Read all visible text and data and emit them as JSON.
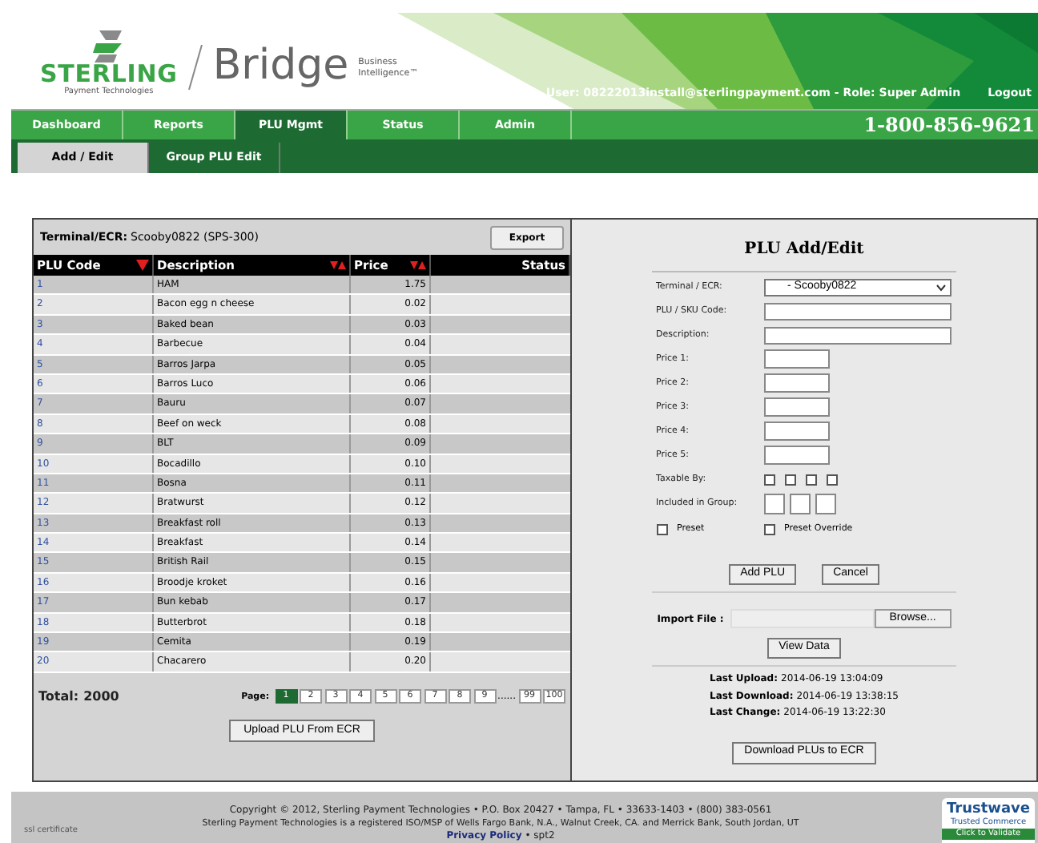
{
  "header": {
    "brand": "STERLING",
    "brand_tagline": "Payment Technologies",
    "product": "Bridge",
    "product_tagline": [
      "Business",
      "Intelligence™"
    ],
    "user_info": "User: 08222013install@sterlingpayment.com - Role: Super Admin",
    "logout": "Logout"
  },
  "nav": {
    "tabs": [
      {
        "label": "Dashboard",
        "selected": false
      },
      {
        "label": "Reports",
        "selected": false
      },
      {
        "label": "PLU Mgmt",
        "selected": true
      },
      {
        "label": "Status",
        "selected": false
      },
      {
        "label": "Admin",
        "selected": false
      }
    ],
    "phone": "1-800-856-9621"
  },
  "subnav": {
    "tabs": [
      {
        "label": "Add / Edit",
        "selected": true
      },
      {
        "label": "Group PLU Edit",
        "selected": false
      }
    ]
  },
  "plu_list": {
    "terminal_label": "Terminal/ECR:",
    "terminal_value": "Scooby0822 (SPS-300)",
    "export_button": "Export",
    "columns": [
      {
        "label": "PLU Code",
        "kind": "sorted"
      },
      {
        "label": "Description",
        "kind": "sortable"
      },
      {
        "label": "Price",
        "kind": "sortable"
      },
      {
        "label": "Status",
        "kind": "plain"
      }
    ],
    "rows": [
      {
        "code": "1",
        "description": "HAM",
        "price": "1.75"
      },
      {
        "code": "2",
        "description": "Bacon egg n cheese",
        "price": "0.02"
      },
      {
        "code": "3",
        "description": "Baked bean",
        "price": "0.03"
      },
      {
        "code": "4",
        "description": "Barbecue",
        "price": "0.04"
      },
      {
        "code": "5",
        "description": "Barros Jarpa",
        "price": "0.05"
      },
      {
        "code": "6",
        "description": "Barros Luco",
        "price": "0.06"
      },
      {
        "code": "7",
        "description": "Bauru",
        "price": "0.07"
      },
      {
        "code": "8",
        "description": "Beef on weck",
        "price": "0.08"
      },
      {
        "code": "9",
        "description": "BLT",
        "price": "0.09"
      },
      {
        "code": "10",
        "description": "Bocadillo",
        "price": "0.10"
      },
      {
        "code": "11",
        "description": "Bosna",
        "price": "0.11"
      },
      {
        "code": "12",
        "description": "Bratwurst",
        "price": "0.12"
      },
      {
        "code": "13",
        "description": "Breakfast roll",
        "price": "0.13"
      },
      {
        "code": "14",
        "description": "Breakfast",
        "price": "0.14"
      },
      {
        "code": "15",
        "description": "British Rail",
        "price": "0.15"
      },
      {
        "code": "16",
        "description": "Broodje kroket",
        "price": "0.16"
      },
      {
        "code": "17",
        "description": "Bun kebab",
        "price": "0.17"
      },
      {
        "code": "18",
        "description": "Butterbrot",
        "price": "0.18"
      },
      {
        "code": "19",
        "description": "Cemita",
        "price": "0.19"
      },
      {
        "code": "20",
        "description": "Chacarero",
        "price": "0.20"
      }
    ],
    "total_label": "Total:",
    "total_value": "2000",
    "page_label": "Page:",
    "pages": [
      {
        "label": "1",
        "selected": true
      },
      {
        "label": "2",
        "selected": false
      },
      {
        "label": "3",
        "selected": false
      },
      {
        "label": "4",
        "selected": false
      },
      {
        "label": "5",
        "selected": false
      },
      {
        "label": "6",
        "selected": false
      },
      {
        "label": "7",
        "selected": false
      },
      {
        "label": "8",
        "selected": false
      },
      {
        "label": "9",
        "selected": false
      }
    ],
    "pages_ellipsis": "......",
    "last_pages": [
      {
        "label": "99",
        "selected": false
      },
      {
        "label": "100",
        "selected": false
      }
    ],
    "upload_button": "Upload PLU From ECR"
  },
  "form": {
    "title": "PLU Add/Edit",
    "fields": [
      {
        "label": "Terminal / ECR:",
        "kind": "select",
        "value": "- Scooby0822"
      },
      {
        "label": "PLU / SKU Code:",
        "kind": "wide"
      },
      {
        "label": "Description:",
        "kind": "wide"
      },
      {
        "label": "Price 1:",
        "kind": "short"
      },
      {
        "label": "Price 2:",
        "kind": "short"
      },
      {
        "label": "Price 3:",
        "kind": "short"
      },
      {
        "label": "Price 4:",
        "kind": "short"
      },
      {
        "label": "Price 5:",
        "kind": "short"
      }
    ],
    "taxable_label": "Taxable By:",
    "taxable": [
      {
        "checked": false
      },
      {
        "checked": false
      },
      {
        "checked": false
      },
      {
        "checked": false
      }
    ],
    "group_label": "Included in Group:",
    "presets": [
      {
        "label": "Preset",
        "checked": false
      },
      {
        "label": "Preset Override",
        "checked": false
      }
    ],
    "buttons": [
      "Add PLU",
      "Cancel"
    ],
    "import_label": "Import File :",
    "browse_button": "Browse...",
    "view_button": "View Data",
    "history": [
      {
        "label": "Last Upload:",
        "value": "2014-06-19 13:04:09"
      },
      {
        "label": "Last Download:",
        "value": "2014-06-19 13:38:15"
      },
      {
        "label": "Last Change:",
        "value": "2014-06-19 13:22:30"
      }
    ],
    "download_button": "Download PLUs to ECR"
  },
  "footer": {
    "ssl": "ssl certificate",
    "copyright": "Copyright © 2012, Sterling Payment Technologies • P.O. Box 20427 • Tampa, FL • 33633-1403 • (800) 383-0561",
    "registered": "Sterling Payment Technologies is a registered ISO/MSP of Wells Fargo Bank, N.A., Walnut Creek, CA. and Merrick Bank, South Jordan, UT",
    "privacy": "Privacy Policy",
    "version": "• spt2",
    "badge": [
      "Trustwave",
      "Trusted Commerce",
      "Click to Validate"
    ]
  }
}
